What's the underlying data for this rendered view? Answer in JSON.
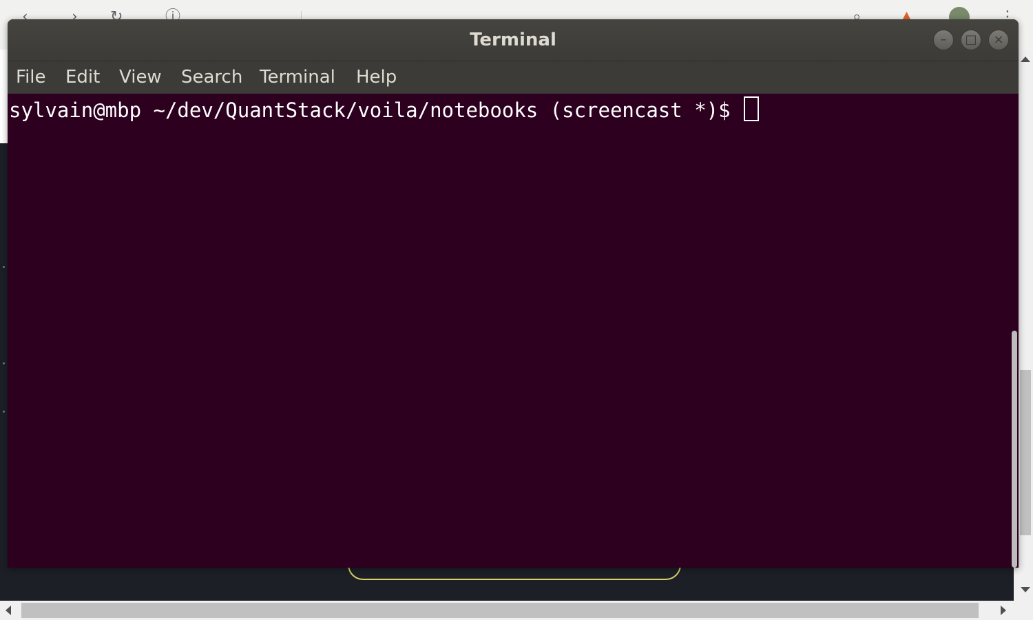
{
  "window": {
    "title": "Terminal"
  },
  "window_controls": {
    "minimize_icon": "minimize-icon",
    "maximize_icon": "maximize-icon",
    "close_icon": "close-icon"
  },
  "menu": {
    "items": [
      {
        "label": "File"
      },
      {
        "label": "Edit"
      },
      {
        "label": "View"
      },
      {
        "label": "Search"
      },
      {
        "label": "Terminal"
      },
      {
        "label": "Help"
      }
    ]
  },
  "terminal": {
    "prompt": "sylvain@mbp ~/dev/QuantStack/voila/notebooks (screencast *)$ ",
    "background": "#2c001e",
    "foreground": "#ffffff"
  },
  "browser_toolbar": {
    "icons": [
      "back-icon",
      "forward-icon",
      "reload-icon",
      "info-icon",
      "search-icon",
      "warning-icon",
      "avatar",
      "more-icon"
    ]
  },
  "colors": {
    "titlebar": "#3c3b37",
    "title_text": "#dfdbd2"
  }
}
